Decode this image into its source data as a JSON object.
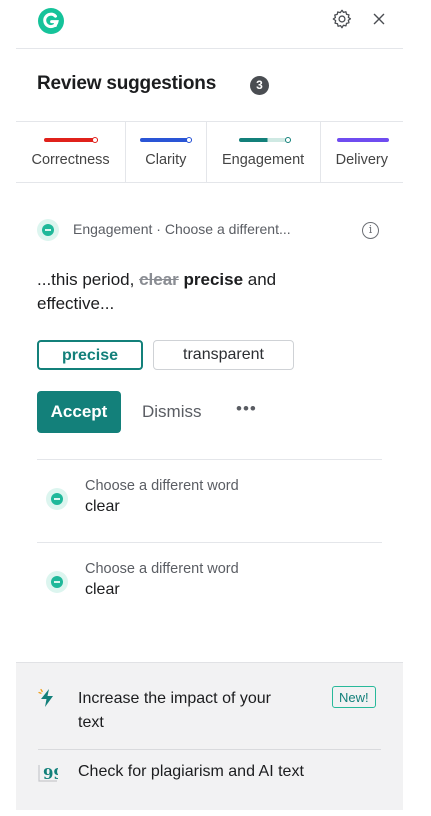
{
  "header": {
    "logo_icon": "grammarly-logo",
    "settings_icon": "gear-icon",
    "close_icon": "close-icon"
  },
  "title": "Review suggestions",
  "suggestion_count": "3",
  "tabs": [
    {
      "label": "Correctness",
      "color": "#e0211b",
      "fill": 1.0
    },
    {
      "label": "Clarity",
      "color": "#2a55d6",
      "fill": 1.0
    },
    {
      "label": "Engagement",
      "color": "#13807a",
      "fill": 0.55
    },
    {
      "label": "Delivery",
      "color": "#6f4cf0",
      "fill": 1.0
    }
  ],
  "active_card": {
    "breadcrumb": "Engagement · Choose a different...",
    "info_symbol": "i",
    "sentence_prefix": "...this period, ",
    "sentence_removed": "clear",
    "sentence_inserted": "precise",
    "sentence_suffix": " and effective...",
    "options": [
      "precise",
      "transparent"
    ],
    "accept_label": "Accept",
    "dismiss_label": "Dismiss",
    "more_label": "•••"
  },
  "other_suggestions": [
    {
      "subtitle": "Choose a different word",
      "word": "clear"
    },
    {
      "subtitle": "Choose a different word",
      "word": "clear"
    }
  ],
  "footer": {
    "promo_text": "Increase the impact of your text",
    "new_badge": "New!",
    "plagiarism_text": "Check for plagiarism and AI text"
  },
  "colors": {
    "accent": "#13807a",
    "engagement": "#1fb89a"
  }
}
